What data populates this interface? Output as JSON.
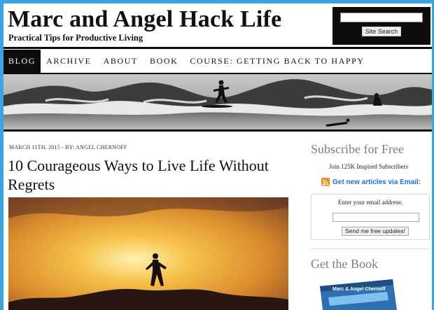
{
  "site": {
    "title": "Marc and Angel Hack Life",
    "tagline": "Practical Tips for Productive Living"
  },
  "search": {
    "button_label": "Site Search",
    "value": ""
  },
  "nav": {
    "items": [
      {
        "label": "BLOG",
        "active": true
      },
      {
        "label": "ARCHIVE",
        "active": false
      },
      {
        "label": "ABOUT",
        "active": false
      },
      {
        "label": "BOOK",
        "active": false
      },
      {
        "label": "COURSE: GETTING BACK TO HAPPY",
        "active": false
      }
    ]
  },
  "post": {
    "meta": "MARCH 11TH, 2015 - BY: ANGEL CHERNOFF",
    "title": "10 Courageous Ways to Live Life Without Regrets"
  },
  "sidebar": {
    "subscribe_heading": "Subscribe for Free",
    "subscriber_count": "Join 125K Inspired Subscribers",
    "rss_link": "Get new articles via Email:",
    "email_label": "Enter your email address:",
    "email_value": "",
    "email_button": "Send me free updates!",
    "book_heading": "Get the Book",
    "book_cover_text": "Marc & Angel Chernoff"
  },
  "colors": {
    "frame": "#3aa6e0",
    "header_black": "#0c0c0c",
    "link_blue": "#1c6fd6",
    "rss_orange": "#f08a24",
    "sidebar_heading": "#7d7d7d"
  },
  "icons": [
    "rss-icon"
  ]
}
